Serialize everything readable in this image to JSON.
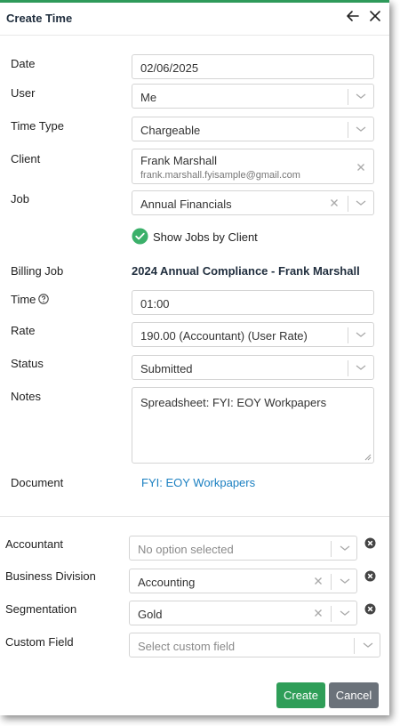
{
  "header": {
    "title": "Create Time"
  },
  "labels": {
    "date": "Date",
    "user": "User",
    "time_type": "Time Type",
    "client": "Client",
    "job": "Job",
    "billing_job": "Billing Job",
    "time": "Time",
    "rate": "Rate",
    "status": "Status",
    "notes": "Notes",
    "document": "Document",
    "accountant": "Accountant",
    "business_division": "Business Division",
    "segmentation": "Segmentation",
    "custom_field": "Custom Field"
  },
  "fields": {
    "date": "02/06/2025",
    "user": "Me",
    "time_type": "Chargeable",
    "client_name": "Frank Marshall",
    "client_email": "frank.marshall.fyisample@gmail.com",
    "job": "Annual Financials",
    "show_jobs_by_client": "Show Jobs by Client",
    "billing_job": "2024 Annual Compliance - Frank Marshall",
    "time": "01:00",
    "rate": "190.00 (Accountant) (User Rate)",
    "status": "Submitted",
    "notes": "Spreadsheet: FYI: EOY Workpapers",
    "document": "FYI: EOY Workpapers",
    "accountant_placeholder": "No option selected",
    "business_division": "Accounting",
    "segmentation": "Gold",
    "custom_field_placeholder": "Select custom field"
  },
  "buttons": {
    "create": "Create",
    "cancel": "Cancel"
  },
  "colors": {
    "accent": "#2e9a5a",
    "link": "#1a7fc1",
    "cancel": "#6b727a"
  }
}
